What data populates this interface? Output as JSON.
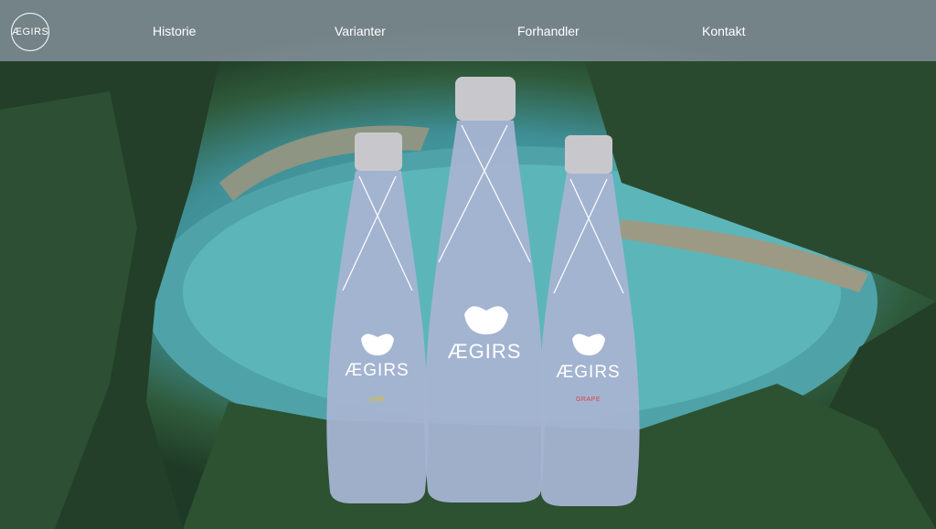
{
  "nav": {
    "logo_text": "ÆGIRS",
    "links": [
      "Historie",
      "Varianter",
      "Forhandler",
      "Kontakt"
    ]
  },
  "bottles": [
    {
      "brand": "ÆGIRS",
      "variant": "LIME",
      "variant_color": "#e5c200"
    },
    {
      "brand": "ÆGIRS",
      "variant": ""
    },
    {
      "brand": "ÆGIRS",
      "variant": "GRAPE",
      "variant_color": "#e04040"
    }
  ],
  "colors": {
    "nav_bg": "#96a0af",
    "bottle_body": "#a6b4d2",
    "cap": "#c8c8cc"
  }
}
